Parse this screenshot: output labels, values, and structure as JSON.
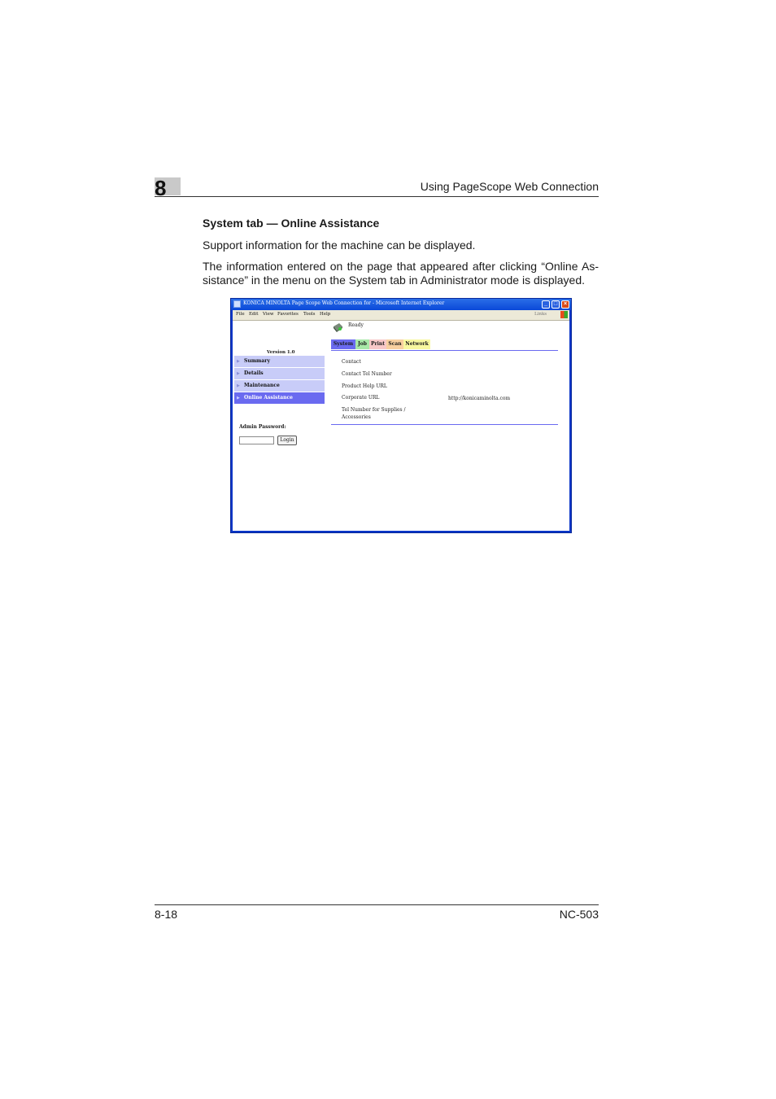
{
  "header": {
    "chapter_number": "8",
    "running_title": "Using PageScope Web Connection"
  },
  "section": {
    "title": "System tab — Online Assistance",
    "paragraph1": "Support information for the machine can be displayed.",
    "paragraph2_line1": "The information entered on the page that appeared after clicking “Online As-",
    "paragraph2_line2": "sistance” in the menu on the System tab in Administrator mode is displayed."
  },
  "screenshot": {
    "window_title": "KONICA MINOLTA Page Scope Web Connection for      - Microsoft Internet Explorer",
    "menu": [
      "File",
      "Edit",
      "View",
      "Favorites",
      "Tools",
      "Help"
    ],
    "links_label": "Links",
    "version": "Version 1.0",
    "nav_items": [
      {
        "label": "Summary"
      },
      {
        "label": "Details"
      },
      {
        "label": "Maintenance"
      },
      {
        "label": "Online Assistance"
      }
    ],
    "active_nav": "Online Assistance",
    "admin_password_label": "Admin Password:",
    "login_label": "Login",
    "status": "Ready",
    "tabs": [
      {
        "label": "System",
        "color": "#6a6af0"
      },
      {
        "label": "Job",
        "color": "#a8e8a8"
      },
      {
        "label": "Print",
        "color": "#f8c8c8"
      },
      {
        "label": "Scan",
        "color": "#f8d0a0"
      },
      {
        "label": "Network",
        "color": "#f8f8a0"
      }
    ],
    "info_rows": [
      {
        "label": "Contact",
        "value": ""
      },
      {
        "label": "Contact Tel Number",
        "value": ""
      },
      {
        "label": "Product Help URL",
        "value": ""
      },
      {
        "label": "Corporate URL",
        "value": "http://konicaminolta.com"
      },
      {
        "label": "Tel Number for Supplies / Accessories",
        "value": ""
      }
    ]
  },
  "footer": {
    "page_number": "8-18",
    "model": "NC-503"
  }
}
